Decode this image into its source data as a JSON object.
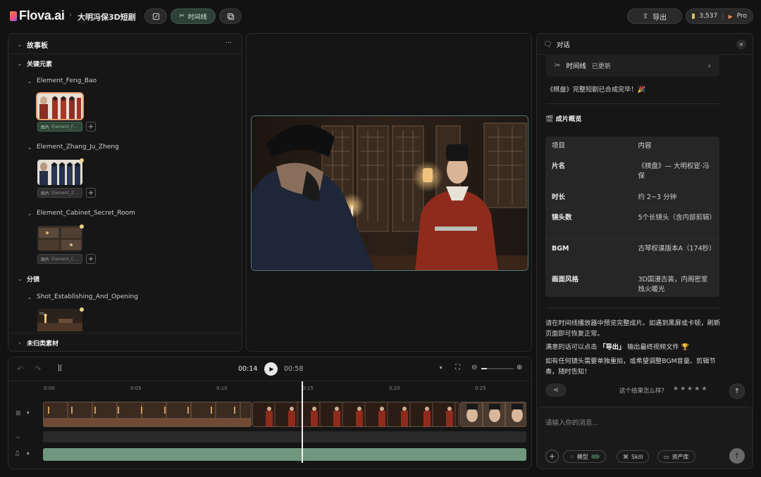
{
  "app": {
    "logo_text": "Flova.ai",
    "breadcrumb_sep": "›",
    "project_title": "大明冯保3D短剧",
    "timeline_tab": "时间线",
    "export_label": "导出",
    "credits": "3,537",
    "plan": "Pro"
  },
  "storyboard": {
    "title": "故事板",
    "more": "···",
    "key_elements_label": "关键元素",
    "elements": [
      {
        "name": "Element_Feng_Bao",
        "tag_kind": "图片",
        "tag_name": "Element_F..."
      },
      {
        "name": "Element_Zhang_Ju_Zheng",
        "tag_kind": "图片",
        "tag_name": "Element_Z..."
      },
      {
        "name": "Element_Cabinet_Secret_Room",
        "tag_kind": "图片",
        "tag_name": "Element_C..."
      }
    ],
    "shots_label": "分镜",
    "shots": [
      {
        "name": "Shot_Establishing_And_Opening"
      }
    ],
    "uncategorized_label": "未归类素材"
  },
  "player": {
    "current_time": "00:14",
    "total_time": "00:58"
  },
  "timeline": {
    "ticks": [
      "0:00",
      "0:05",
      "0:10",
      "0:15",
      "0:20",
      "0:25"
    ]
  },
  "chat": {
    "title": "对话",
    "timeline_card": {
      "label": "时间线",
      "status": "已更新"
    },
    "done_msg": "《棋盘》完整短剧已合成完毕！🎉",
    "summary_title": "🎬 成片概览",
    "table_headers": [
      "项目",
      "内容"
    ],
    "table_rows": [
      {
        "key": "片名",
        "value": "《棋盘》— 大明权宦·冯保"
      },
      {
        "key": "时长",
        "value": "约 2~3 分钟"
      },
      {
        "key": "镜头数",
        "value": "5个长镜头（含内部剪辑）"
      },
      {
        "key": "BGM",
        "value": "古琴权谋版本A（174秒）"
      },
      {
        "key": "画面风格",
        "value": "3D国漫古装，内阁密室烛火暖光"
      }
    ],
    "note1": "请在时间线播放器中预览完整成片。如遇到黑屏或卡顿，刷新页面即可恢复正常。",
    "note2_prefix": "满意的话可以点击",
    "note2_bold": "「导出」",
    "note2_suffix": "输出最终视频文件 🏆",
    "note3": "如有任何镜头需要单独重拍，或希望调整BGM音量、剪辑节奏，随时告知！",
    "feedback_q": "这个结果怎么样?",
    "input_placeholder": "请输入你的消息...",
    "chips": {
      "model": "模型",
      "skill": "Skill",
      "assets": "资产库"
    }
  }
}
